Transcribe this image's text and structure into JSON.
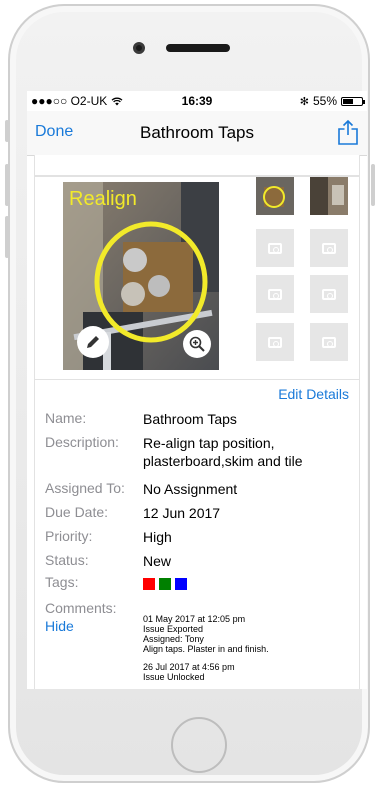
{
  "status": {
    "carrier": "●●●○○ O2-UK",
    "wifi": "wifi-icon",
    "time": "16:39",
    "bluetooth": "✻",
    "battery_text": "55%",
    "battery_level": 0.55
  },
  "nav": {
    "done": "Done",
    "title": "Bathroom Taps",
    "share_icon": "share-icon"
  },
  "photo": {
    "overlay_text": "Realign",
    "edit_icon": "pencil-icon",
    "zoom_icon": "zoom-in-icon",
    "empty_slot_icon": "camera-icon"
  },
  "details": {
    "edit_link": "Edit Details",
    "name": {
      "label": "Name:",
      "value": "Bathroom Taps"
    },
    "description": {
      "label": "Description:",
      "value": "Re-align tap position, plasterboard,skim and tile"
    },
    "assigned": {
      "label": "Assigned To:",
      "value": "No Assignment"
    },
    "due": {
      "label": "Due Date:",
      "value": "12 Jun 2017"
    },
    "priority": {
      "label": "Priority:",
      "value": "High"
    },
    "status": {
      "label": "Status:",
      "value": "New"
    },
    "tags": {
      "label": "Tags:",
      "colors": [
        "#ff0000",
        "#008000",
        "#0000ff"
      ]
    },
    "comments": {
      "label": "Comments:",
      "hide": "Hide",
      "entries": [
        {
          "date": "01 May 2017 at 12:05 pm",
          "lines": [
            "Issue Exported",
            "Assigned: Tony",
            "Align taps. Plaster in and finish."
          ]
        },
        {
          "date": "26 Jul 2017 at 4:56 pm",
          "lines": [
            "Issue Unlocked"
          ]
        }
      ]
    }
  },
  "colors": {
    "accent": "#1a7ad9",
    "highlight": "#f2ea2a"
  }
}
